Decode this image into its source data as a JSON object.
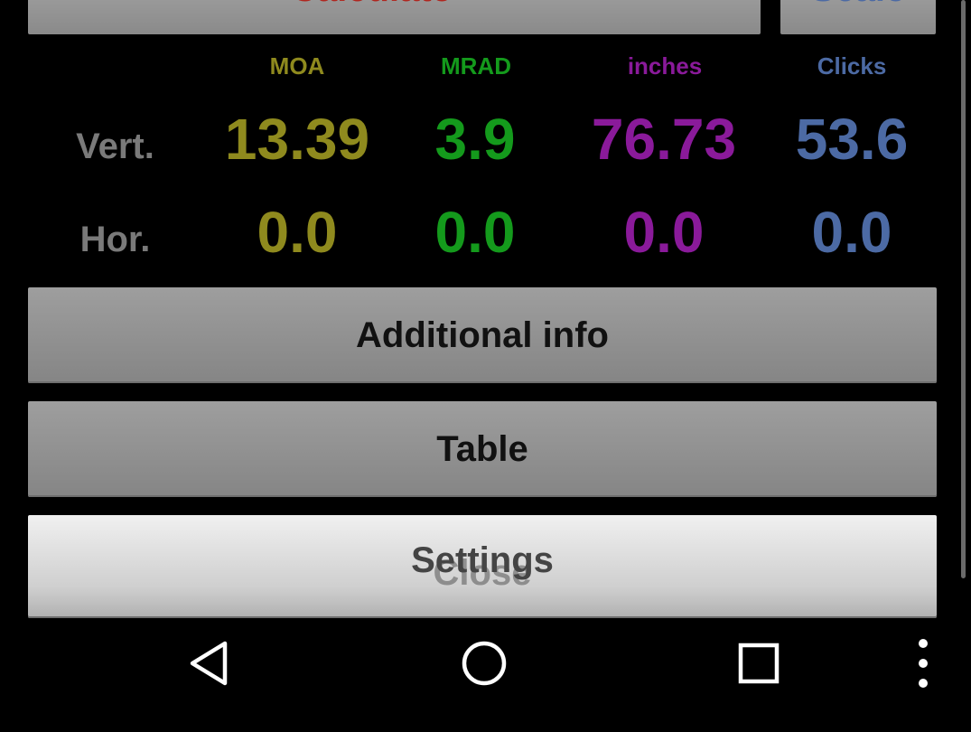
{
  "top_buttons": {
    "calculate_label": "Calculate",
    "scale_label": "Scale"
  },
  "columns": {
    "moa": "MOA",
    "mrad": "MRAD",
    "inches": "inches",
    "clicks": "Clicks"
  },
  "rows": {
    "vert": {
      "label": "Vert.",
      "moa": "13.39",
      "mrad": "3.9",
      "inches": "76.73",
      "clicks": "53.6"
    },
    "hor": {
      "label": "Hor.",
      "moa": "0.0",
      "mrad": "0.0",
      "inches": "0.0",
      "clicks": "0.0"
    }
  },
  "buttons": {
    "additional_info": "Additional info",
    "table": "Table",
    "settings": "Settings",
    "close": "Close"
  },
  "navbar": {
    "back_icon": "back-triangle-icon",
    "home_icon": "home-circle-icon",
    "recents_icon": "recents-square-icon",
    "menu_icon": "overflow-menu-icon"
  },
  "colors": {
    "moa": "#8f8a1e",
    "mrad": "#149a1c",
    "inches": "#8a1a9a",
    "clicks": "#4c6aa4",
    "label": "#7a7a7a"
  }
}
